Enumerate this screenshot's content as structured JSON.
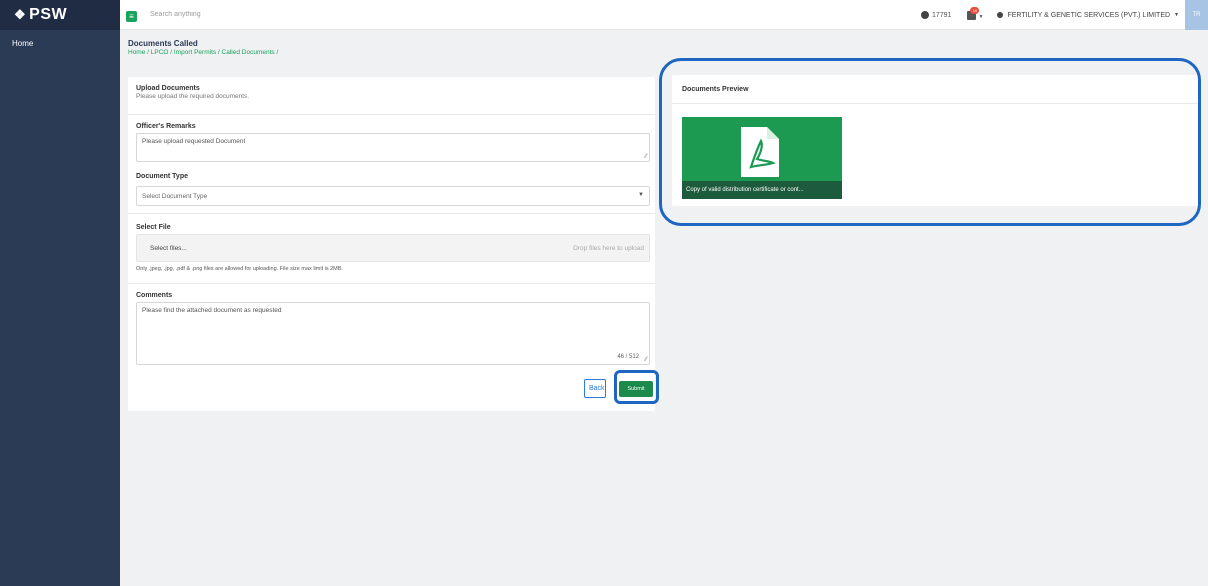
{
  "brand": {
    "logo": "PSW"
  },
  "sidebar": {
    "items": [
      {
        "label": "Home"
      }
    ]
  },
  "topbar": {
    "search_placeholder": "Search anything",
    "count": "17791",
    "notification_badge": "10",
    "user_name": "FERTILITY & GENETIC SERVICES (PVT.) LIMITED",
    "avatar_initials": "TR"
  },
  "page": {
    "title": "Documents Called",
    "breadcrumb": "Home / LPCO / Import Permits / Called Documents /"
  },
  "form": {
    "upload_title": "Upload Documents",
    "upload_subtitle": "Please upload the required documents.",
    "remarks_label": "Officer's Remarks",
    "remarks_value": "Please upload requested Document",
    "doc_type_label": "Document Type",
    "doc_type_placeholder": "Select Document Type",
    "select_file_label": "Select File",
    "select_files_button": "Select files...",
    "drop_hint": "Drop files here to upload",
    "file_note": "Only .jpeg, .jpg, .pdf & .png files are allowed for uploading. File size max limit is 2MB.",
    "comments_label": "Comments",
    "comments_value": "Please find the attached document as requested",
    "comments_counter": "46 / 512",
    "back_button": "Back",
    "submit_button": "Submit"
  },
  "preview": {
    "title": "Documents Preview",
    "items": [
      {
        "caption": "Copy of valid distribution certificate or cont..."
      }
    ]
  },
  "colors": {
    "sidebar": "#2b3a55",
    "accent_green": "#1aa35a",
    "highlight_blue": "#1d66c2"
  }
}
